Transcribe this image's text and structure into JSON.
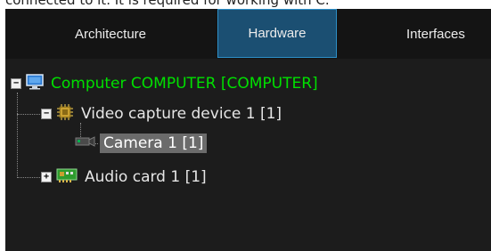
{
  "top_text": "connected to it. It is required for working with C.",
  "tabs": [
    {
      "label": "Architecture"
    },
    {
      "label": "Hardware",
      "active": true
    },
    {
      "label": "Interfaces"
    }
  ],
  "tree": {
    "computer": {
      "label": "Computer COMPUTER [COMPUTER]",
      "expander": "−",
      "color": "#00e000"
    },
    "video_capture": {
      "label": "Video capture device 1 [1]",
      "expander": "−"
    },
    "camera": {
      "label": "Camera 1 [1]",
      "selected": true
    },
    "audio_card": {
      "label": "Audio card 1 [1]",
      "expander": "+"
    }
  },
  "colors": {
    "background": "#1c1c1c",
    "tab_active": "#1b4f72",
    "tab_active_border": "#2d8fc7",
    "selected_row": "#6b6b6b"
  }
}
